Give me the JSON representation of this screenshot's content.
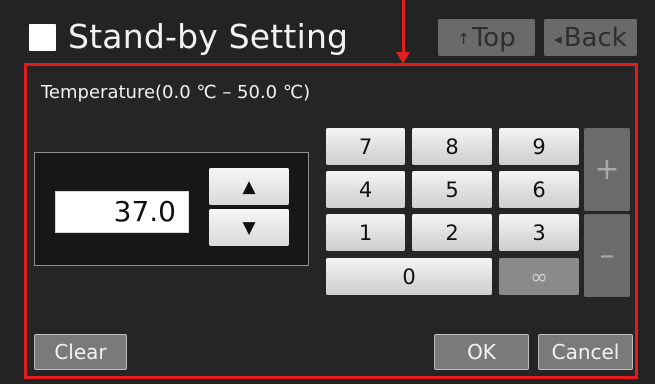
{
  "header": {
    "title": "Stand-by Setting",
    "top_glyph": "↑",
    "top_label": "Top",
    "back_glyph": "◂",
    "back_label": "Back"
  },
  "panel": {
    "label": "Temperature(0.0 ℃ – 50.0 ℃)",
    "value": "37.0",
    "increase_glyph": "▲",
    "decrease_glyph": "▼"
  },
  "keypad": {
    "keys": [
      "7",
      "8",
      "9",
      "4",
      "5",
      "6",
      "1",
      "2",
      "3",
      "0"
    ],
    "infinity_label": "∞",
    "plus_label": "+",
    "minus_label": "–"
  },
  "footer": {
    "clear_label": "Clear",
    "ok_label": "OK",
    "cancel_label": "Cancel"
  },
  "colors": {
    "background": "#232323",
    "annotation": "#e21c1c",
    "key_face": "#e8e8e8",
    "disabled_key": "#6b6b6b"
  }
}
